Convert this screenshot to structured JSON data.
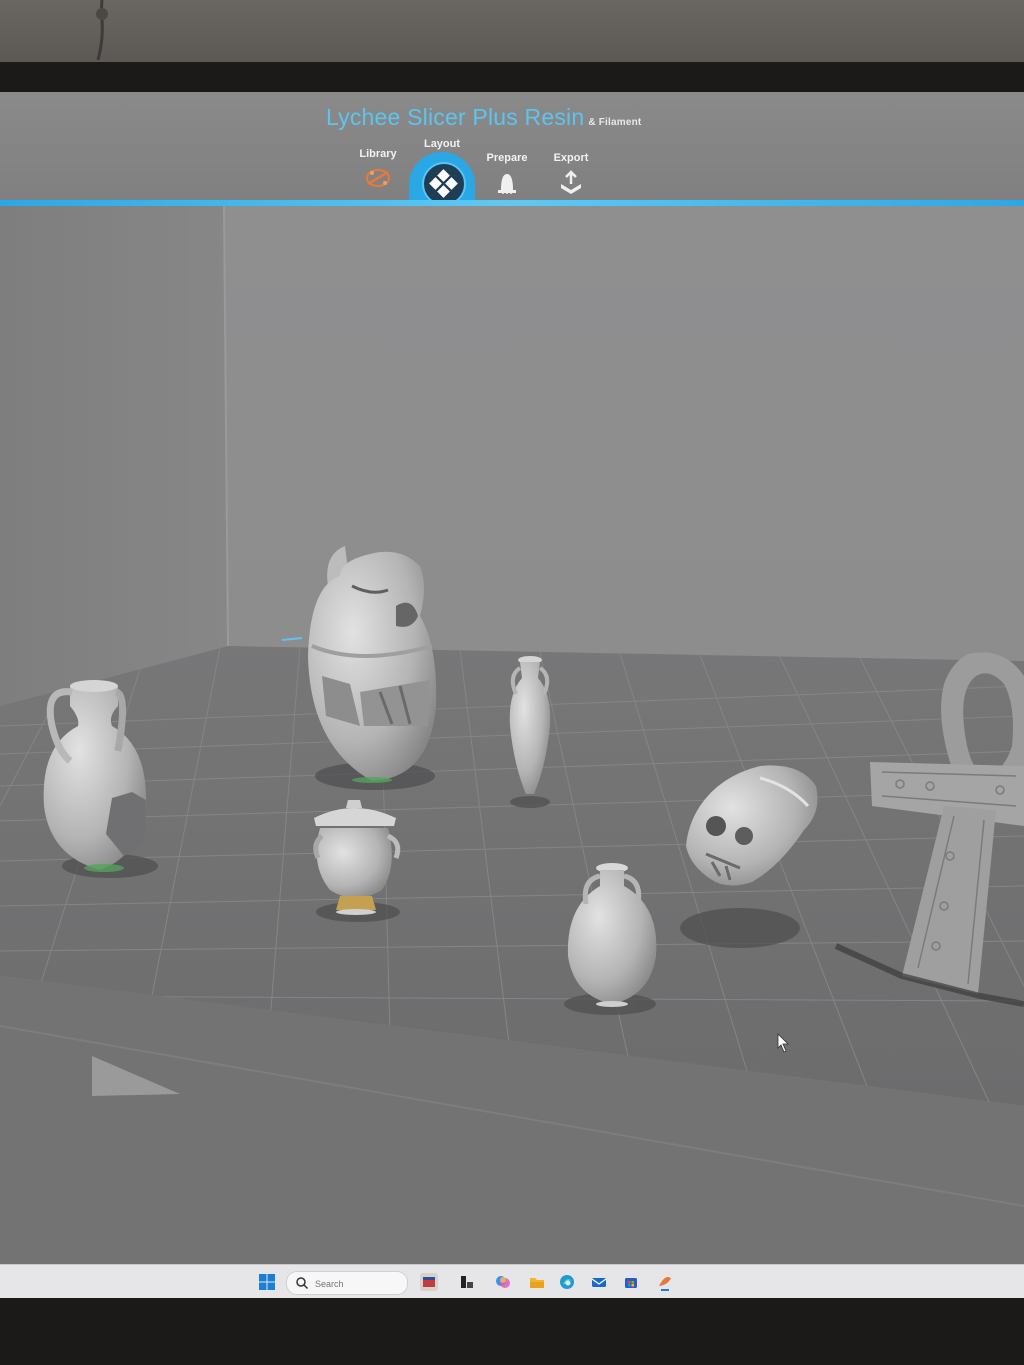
{
  "app": {
    "title": "Lychee Slicer Plus Resin",
    "title_suffix": "& Filament"
  },
  "tabs": [
    {
      "label": "Library",
      "icon": "library-icon",
      "active": false
    },
    {
      "label": "Layout",
      "icon": "layout-icon",
      "active": true
    },
    {
      "label": "Prepare",
      "icon": "prepare-icon",
      "active": false
    },
    {
      "label": "Export",
      "icon": "export-icon",
      "active": false
    }
  ],
  "colors": {
    "accent": "#2aa8e6",
    "title": "#5cc5ef",
    "viewport_bg": "#8a8a8a",
    "plate": "#6f6f70",
    "model": "#b9b9b9"
  },
  "scene_models": [
    {
      "name": "large-amphora",
      "icon": "vase-icon"
    },
    {
      "name": "carved-figure",
      "icon": "statue-icon"
    },
    {
      "name": "small-amphora",
      "icon": "vase-icon"
    },
    {
      "name": "lidded-pot",
      "icon": "pot-icon"
    },
    {
      "name": "round-jug",
      "icon": "vase-icon"
    },
    {
      "name": "skull",
      "icon": "skull-icon"
    },
    {
      "name": "ankh",
      "icon": "ankh-icon"
    }
  ],
  "taskbar": {
    "search_placeholder": "Search",
    "apps": [
      "start-icon",
      "widgets-icon",
      "taskview-icon",
      "copilot-icon",
      "file-explorer-icon",
      "edge-icon",
      "mail-icon",
      "store-icon",
      "lychee-icon"
    ]
  }
}
